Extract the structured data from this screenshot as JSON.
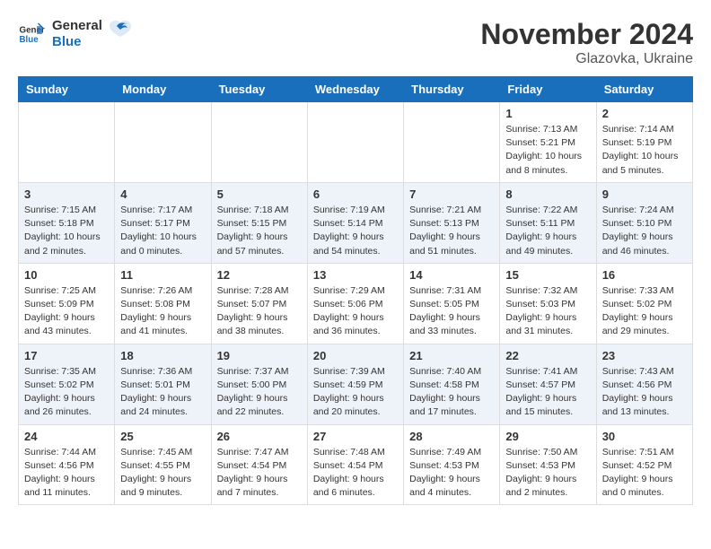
{
  "header": {
    "logo_line1": "General",
    "logo_line2": "Blue",
    "month_year": "November 2024",
    "location": "Glazovka, Ukraine"
  },
  "weekdays": [
    "Sunday",
    "Monday",
    "Tuesday",
    "Wednesday",
    "Thursday",
    "Friday",
    "Saturday"
  ],
  "weeks": [
    [
      {
        "day": "",
        "info": ""
      },
      {
        "day": "",
        "info": ""
      },
      {
        "day": "",
        "info": ""
      },
      {
        "day": "",
        "info": ""
      },
      {
        "day": "",
        "info": ""
      },
      {
        "day": "1",
        "info": "Sunrise: 7:13 AM\nSunset: 5:21 PM\nDaylight: 10 hours and 8 minutes."
      },
      {
        "day": "2",
        "info": "Sunrise: 7:14 AM\nSunset: 5:19 PM\nDaylight: 10 hours and 5 minutes."
      }
    ],
    [
      {
        "day": "3",
        "info": "Sunrise: 7:15 AM\nSunset: 5:18 PM\nDaylight: 10 hours and 2 minutes."
      },
      {
        "day": "4",
        "info": "Sunrise: 7:17 AM\nSunset: 5:17 PM\nDaylight: 10 hours and 0 minutes."
      },
      {
        "day": "5",
        "info": "Sunrise: 7:18 AM\nSunset: 5:15 PM\nDaylight: 9 hours and 57 minutes."
      },
      {
        "day": "6",
        "info": "Sunrise: 7:19 AM\nSunset: 5:14 PM\nDaylight: 9 hours and 54 minutes."
      },
      {
        "day": "7",
        "info": "Sunrise: 7:21 AM\nSunset: 5:13 PM\nDaylight: 9 hours and 51 minutes."
      },
      {
        "day": "8",
        "info": "Sunrise: 7:22 AM\nSunset: 5:11 PM\nDaylight: 9 hours and 49 minutes."
      },
      {
        "day": "9",
        "info": "Sunrise: 7:24 AM\nSunset: 5:10 PM\nDaylight: 9 hours and 46 minutes."
      }
    ],
    [
      {
        "day": "10",
        "info": "Sunrise: 7:25 AM\nSunset: 5:09 PM\nDaylight: 9 hours and 43 minutes."
      },
      {
        "day": "11",
        "info": "Sunrise: 7:26 AM\nSunset: 5:08 PM\nDaylight: 9 hours and 41 minutes."
      },
      {
        "day": "12",
        "info": "Sunrise: 7:28 AM\nSunset: 5:07 PM\nDaylight: 9 hours and 38 minutes."
      },
      {
        "day": "13",
        "info": "Sunrise: 7:29 AM\nSunset: 5:06 PM\nDaylight: 9 hours and 36 minutes."
      },
      {
        "day": "14",
        "info": "Sunrise: 7:31 AM\nSunset: 5:05 PM\nDaylight: 9 hours and 33 minutes."
      },
      {
        "day": "15",
        "info": "Sunrise: 7:32 AM\nSunset: 5:03 PM\nDaylight: 9 hours and 31 minutes."
      },
      {
        "day": "16",
        "info": "Sunrise: 7:33 AM\nSunset: 5:02 PM\nDaylight: 9 hours and 29 minutes."
      }
    ],
    [
      {
        "day": "17",
        "info": "Sunrise: 7:35 AM\nSunset: 5:02 PM\nDaylight: 9 hours and 26 minutes."
      },
      {
        "day": "18",
        "info": "Sunrise: 7:36 AM\nSunset: 5:01 PM\nDaylight: 9 hours and 24 minutes."
      },
      {
        "day": "19",
        "info": "Sunrise: 7:37 AM\nSunset: 5:00 PM\nDaylight: 9 hours and 22 minutes."
      },
      {
        "day": "20",
        "info": "Sunrise: 7:39 AM\nSunset: 4:59 PM\nDaylight: 9 hours and 20 minutes."
      },
      {
        "day": "21",
        "info": "Sunrise: 7:40 AM\nSunset: 4:58 PM\nDaylight: 9 hours and 17 minutes."
      },
      {
        "day": "22",
        "info": "Sunrise: 7:41 AM\nSunset: 4:57 PM\nDaylight: 9 hours and 15 minutes."
      },
      {
        "day": "23",
        "info": "Sunrise: 7:43 AM\nSunset: 4:56 PM\nDaylight: 9 hours and 13 minutes."
      }
    ],
    [
      {
        "day": "24",
        "info": "Sunrise: 7:44 AM\nSunset: 4:56 PM\nDaylight: 9 hours and 11 minutes."
      },
      {
        "day": "25",
        "info": "Sunrise: 7:45 AM\nSunset: 4:55 PM\nDaylight: 9 hours and 9 minutes."
      },
      {
        "day": "26",
        "info": "Sunrise: 7:47 AM\nSunset: 4:54 PM\nDaylight: 9 hours and 7 minutes."
      },
      {
        "day": "27",
        "info": "Sunrise: 7:48 AM\nSunset: 4:54 PM\nDaylight: 9 hours and 6 minutes."
      },
      {
        "day": "28",
        "info": "Sunrise: 7:49 AM\nSunset: 4:53 PM\nDaylight: 9 hours and 4 minutes."
      },
      {
        "day": "29",
        "info": "Sunrise: 7:50 AM\nSunset: 4:53 PM\nDaylight: 9 hours and 2 minutes."
      },
      {
        "day": "30",
        "info": "Sunrise: 7:51 AM\nSunset: 4:52 PM\nDaylight: 9 hours and 0 minutes."
      }
    ]
  ]
}
